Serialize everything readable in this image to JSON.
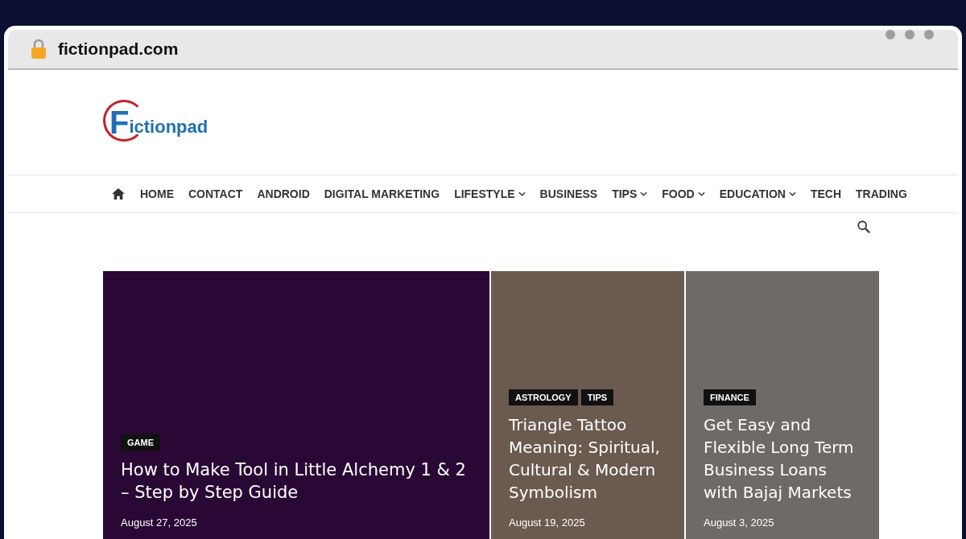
{
  "browser": {
    "address": "fictionpad.com"
  },
  "site": {
    "logo_initial": "F",
    "logo_rest": "ictionpad"
  },
  "nav": [
    {
      "label": "HOME",
      "dropdown": false
    },
    {
      "label": "CONTACT",
      "dropdown": false
    },
    {
      "label": "ANDROID",
      "dropdown": false
    },
    {
      "label": "DIGITAL MARKETING",
      "dropdown": false
    },
    {
      "label": "LIFESTYLE",
      "dropdown": true
    },
    {
      "label": "BUSINESS",
      "dropdown": false
    },
    {
      "label": "TIPS",
      "dropdown": true
    },
    {
      "label": "FOOD",
      "dropdown": true
    },
    {
      "label": "EDUCATION",
      "dropdown": true
    },
    {
      "label": "TECH",
      "dropdown": false
    },
    {
      "label": "TRADING",
      "dropdown": false
    }
  ],
  "posts": [
    {
      "tags": [
        "GAME"
      ],
      "title": "How to Make Tool in Little Alchemy 1 & 2 – Step by Step Guide",
      "date": "August 27, 2025",
      "color": "#2a0836"
    },
    {
      "tags": [
        "ASTROLOGY",
        "TIPS"
      ],
      "title": "Triangle Tattoo Meaning: Spiritual, Cultural & Modern Symbolism",
      "date": "August 19, 2025",
      "color": "#6b5a50"
    },
    {
      "tags": [
        "FINANCE"
      ],
      "title": "Get Easy and Flexible Long Term Business Loans with Bajaj Markets",
      "date": "August 3, 2025",
      "color": "#6e6a68"
    }
  ]
}
